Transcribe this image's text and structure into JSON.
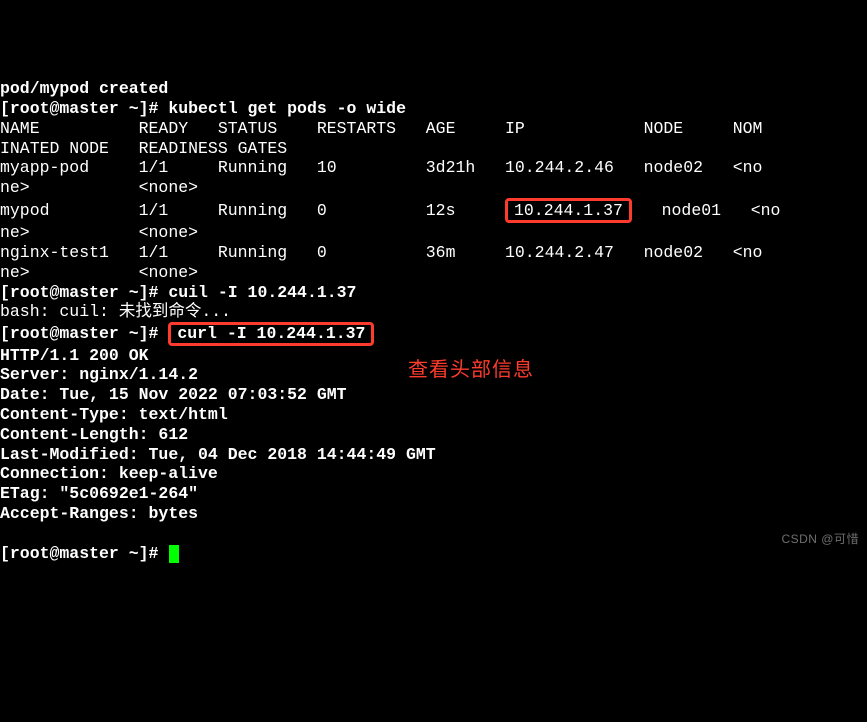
{
  "lines": {
    "created": "pod/mypod created",
    "prompt1": "[root@master ~]# ",
    "cmd1": "kubectl get pods -o wide",
    "hdr": "NAME          READY   STATUS    RESTARTS   AGE     IP            NODE     NOM",
    "hdr2": "INATED NODE   READINESS GATES",
    "r1a": "myapp-pod     1/1     Running   10         3d21h   10.244.2.46   node02   <no",
    "r1b": "ne>           <none>",
    "r2a_pre": "mypod         1/1     Running   0          12s     ",
    "r2a_ip": "10.244.1.37",
    "r2a_post": "   node01   <no",
    "r2b": "ne>           <none>",
    "r3a": "nginx-test1   1/1     Running   0          36m     10.244.2.47   node02   <no",
    "r3b": "ne>           <none>",
    "prompt2": "[root@master ~]# ",
    "cmd2": "cuil -I 10.244.1.37",
    "bash_err": "bash: cuil: 未找到命令...",
    "prompt3": "[root@master ~]# ",
    "cmd3": "curl -I 10.244.1.37",
    "http1": "HTTP/1.1 200 OK",
    "http2": "Server: nginx/1.14.2",
    "http3": "Date: Tue, 15 Nov 2022 07:03:52 GMT",
    "http4": "Content-Type: text/html",
    "http5": "Content-Length: 612",
    "http6": "Last-Modified: Tue, 04 Dec 2018 14:44:49 GMT",
    "http7": "Connection: keep-alive",
    "http8": "ETag: \"5c0692e1-264\"",
    "http9": "Accept-Ranges: bytes",
    "blank": "",
    "prompt4": "[root@master ~]# "
  },
  "annotation": "查看头部信息",
  "watermark": "CSDN @可惜"
}
